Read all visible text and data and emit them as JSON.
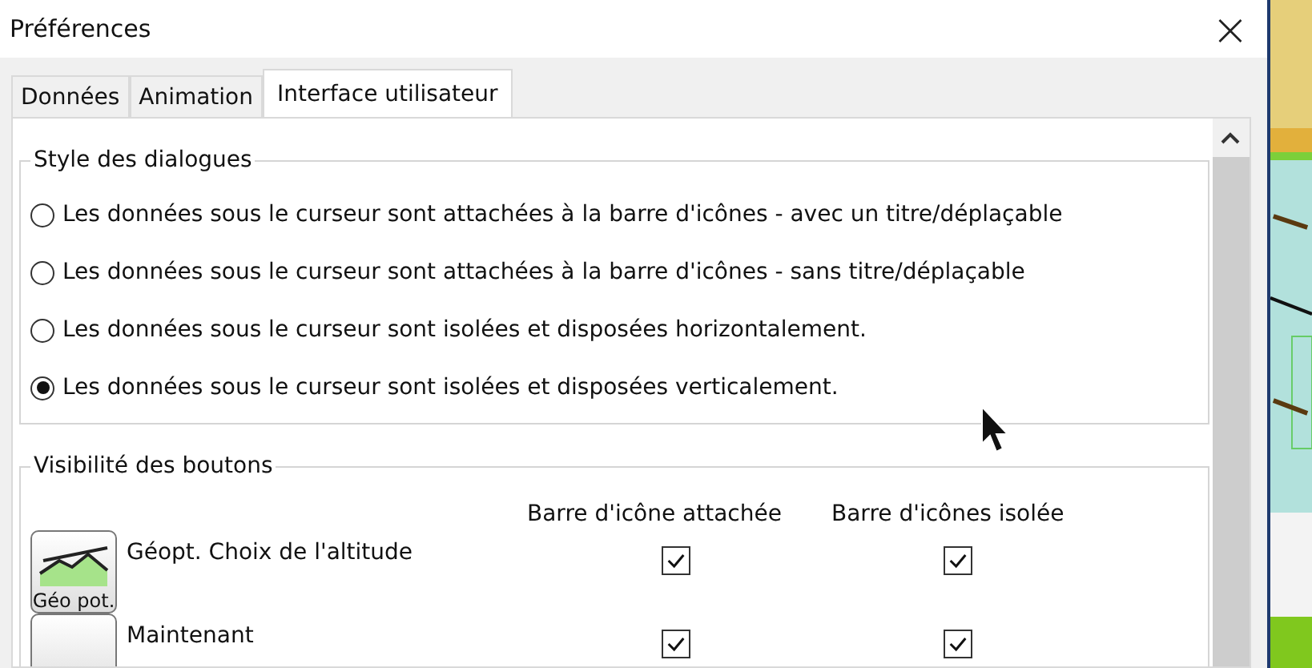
{
  "window": {
    "title": "Préférences",
    "close": "×"
  },
  "tabs": [
    {
      "label": "Données",
      "selected": false
    },
    {
      "label": "Animation",
      "selected": false
    },
    {
      "label": "Interface utilisateur",
      "selected": true
    }
  ],
  "dialog_style": {
    "title": "Style des dialogues",
    "options": [
      {
        "label": "Les données sous le curseur sont attachées à la barre d'icônes - avec un titre/déplaçable",
        "selected": false
      },
      {
        "label": "Les données sous le curseur sont attachées à la barre d'icônes - sans titre/déplaçable",
        "selected": false
      },
      {
        "label": "Les données sous le curseur sont isolées et disposées horizontalement.",
        "selected": false
      },
      {
        "label": "Les données sous le curseur sont isolées et disposées verticalement.",
        "selected": true
      }
    ]
  },
  "button_visibility": {
    "title": "Visibilité des boutons",
    "columns": [
      "Barre d'icône attachée",
      "Barre d'icônes isolée"
    ],
    "rows": [
      {
        "icon_label": "Géo pot.",
        "label": "Géopt. Choix de l'altitude",
        "attached": true,
        "isolated": true
      },
      {
        "label": "Maintenant",
        "attached": true,
        "isolated": true
      }
    ]
  }
}
